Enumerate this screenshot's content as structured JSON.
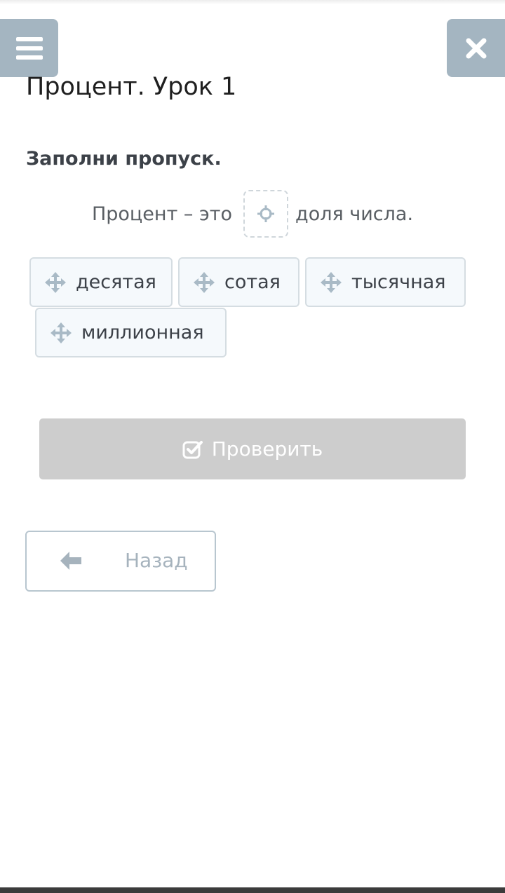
{
  "header": {
    "menu_icon": "hamburger-menu-icon",
    "close_icon": "close-x-icon",
    "title": "Процент. Урок 1"
  },
  "task": {
    "instruction": "Заполни пропуск.",
    "sentence_before": "Процент – это",
    "sentence_after": "доля числа.",
    "gap_icon": "crosshair-target-icon"
  },
  "options": [
    {
      "label": "десятая",
      "icon": "move-arrows-icon"
    },
    {
      "label": "сотая",
      "icon": "move-arrows-icon"
    },
    {
      "label": "тысячная",
      "icon": "move-arrows-icon"
    },
    {
      "label": "миллионная",
      "icon": "move-arrows-icon"
    }
  ],
  "actions": {
    "check_label": "Проверить",
    "check_icon": "checkbox-check-icon",
    "back_label": "Назад",
    "back_icon": "arrow-left-icon"
  },
  "colors": {
    "corner_button": "#a4b5c1",
    "chip_background": "#f5f9fc",
    "chip_border": "#d5dde2",
    "check_button_disabled": "#cdcdcd",
    "back_text": "#a6b3bd"
  }
}
